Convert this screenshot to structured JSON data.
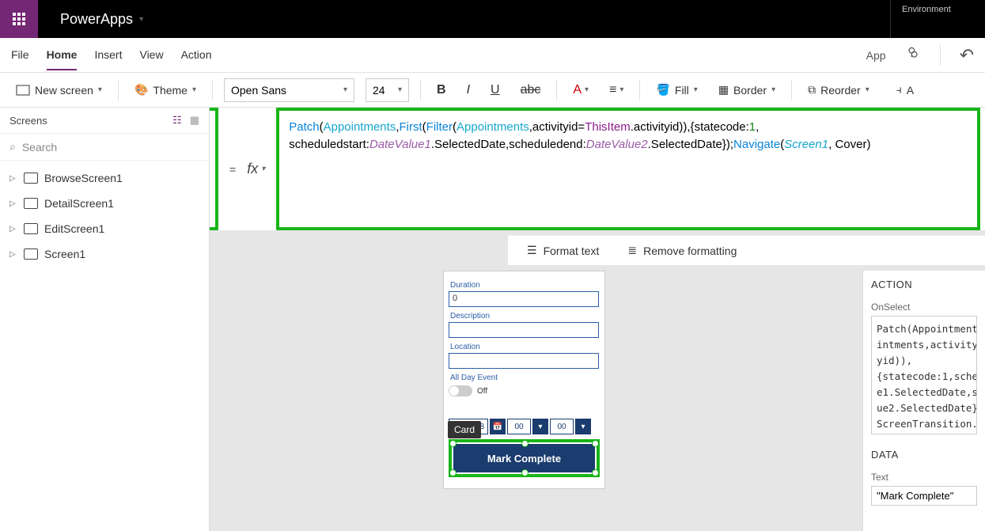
{
  "topbar": {
    "app": "PowerApps",
    "env_label": "Environment"
  },
  "menu": {
    "items": [
      "File",
      "Home",
      "Insert",
      "View",
      "Action"
    ],
    "active": "Home",
    "app_btn": "App"
  },
  "ribbon": {
    "new_screen": "New screen",
    "theme": "Theme",
    "font": "Open Sans",
    "size": "24",
    "fill": "Fill",
    "border": "Border",
    "reorder": "Reorder",
    "align_suffix": "A"
  },
  "property": {
    "selected": "OnSelect"
  },
  "formula_tokens": [
    {
      "t": "fn",
      "v": "Patch"
    },
    {
      "t": "",
      "v": "("
    },
    {
      "t": "tbl",
      "v": "Appointments"
    },
    {
      "t": "",
      "v": ","
    },
    {
      "t": "fn",
      "v": "First"
    },
    {
      "t": "",
      "v": "("
    },
    {
      "t": "fn",
      "v": "Filter"
    },
    {
      "t": "",
      "v": "("
    },
    {
      "t": "tbl",
      "v": "Appointments"
    },
    {
      "t": "",
      "v": ",activityid="
    },
    {
      "t": "kw",
      "v": "ThisItem"
    },
    {
      "t": "",
      "v": ".activityid)),{statecode:"
    },
    {
      "t": "num",
      "v": "1"
    },
    {
      "t": "",
      "v": ", scheduledstart:"
    },
    {
      "t": "ital",
      "v": "DateValue1"
    },
    {
      "t": "",
      "v": ".SelectedDate,scheduledend:"
    },
    {
      "t": "ital",
      "v": "DateValue2"
    },
    {
      "t": "",
      "v": ".SelectedDate});"
    },
    {
      "t": "fn",
      "v": "Navigate"
    },
    {
      "t": "",
      "v": "("
    },
    {
      "t": "scr",
      "v": "Screen1"
    },
    {
      "t": "",
      "v": ", Cover)"
    }
  ],
  "fmt": {
    "format": "Format text",
    "remove": "Remove formatting"
  },
  "screens": {
    "header": "Screens",
    "search": "Search",
    "items": [
      "BrowseScreen1",
      "DetailScreen1",
      "EditScreen1",
      "Screen1"
    ]
  },
  "canvas": {
    "duration_lbl": "Duration",
    "duration_val": "0",
    "description_lbl": "Description",
    "location_lbl": "Location",
    "allday_lbl": "All Day Event",
    "off": "Off",
    "card_tip": "Card",
    "date_b": "8",
    "date_h1": "00",
    "date_h2": "00",
    "btn": "Mark Complete"
  },
  "rpanel": {
    "action_hdr": "ACTION",
    "onselect_lbl": "OnSelect",
    "onselect_code": "Patch(Appointment\nintments,activity\nyid)),\n{statecode:1,sche\ne1.SelectedDate,s\nue2.SelectedDate}\nScreenTransition.",
    "data_hdr": "DATA",
    "text_lbl": "Text",
    "text_val": "\"Mark Complete\""
  }
}
